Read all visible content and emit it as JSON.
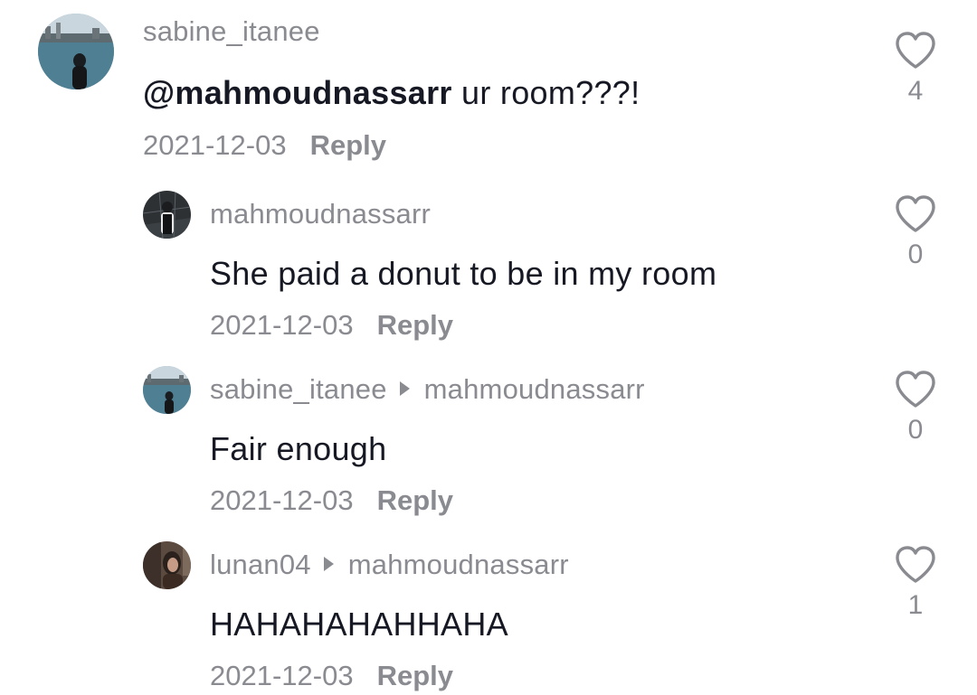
{
  "comments": [
    {
      "username": "sabine_itanee",
      "mention": "@mahmoudnassarr",
      "text": " ur room???!",
      "date": "2021-12-03",
      "reply_label": "Reply",
      "likes": "4"
    },
    {
      "username": "mahmoudnassarr",
      "text": "She paid a donut to be in my room",
      "date": "2021-12-03",
      "reply_label": "Reply",
      "likes": "0"
    },
    {
      "username": "sabine_itanee",
      "reply_to": "mahmoudnassarr",
      "text": "Fair enough",
      "date": "2021-12-03",
      "reply_label": "Reply",
      "likes": "0"
    },
    {
      "username": "lunan04",
      "reply_to": "mahmoudnassarr",
      "text": "HAHAHAHAHHAHA",
      "date": "2021-12-03",
      "reply_label": "Reply",
      "likes": "1"
    }
  ],
  "icons": {
    "like": "heart-outline-icon",
    "reply_to": "play-triangle-icon"
  },
  "colors": {
    "primary_text": "#161823",
    "secondary_text": "#8a8b91",
    "icon_stroke": "#8a8b91"
  }
}
